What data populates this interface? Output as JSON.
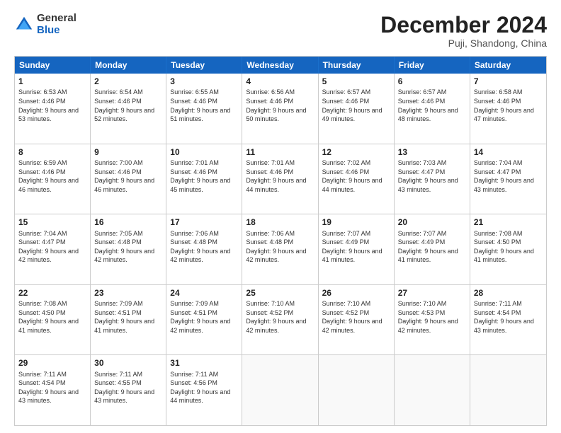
{
  "logo": {
    "general": "General",
    "blue": "Blue"
  },
  "title": "December 2024",
  "subtitle": "Puji, Shandong, China",
  "header_days": [
    "Sunday",
    "Monday",
    "Tuesday",
    "Wednesday",
    "Thursday",
    "Friday",
    "Saturday"
  ],
  "rows": [
    [
      {
        "day": "1",
        "sunrise": "Sunrise: 6:53 AM",
        "sunset": "Sunset: 4:46 PM",
        "daylight": "Daylight: 9 hours and 53 minutes."
      },
      {
        "day": "2",
        "sunrise": "Sunrise: 6:54 AM",
        "sunset": "Sunset: 4:46 PM",
        "daylight": "Daylight: 9 hours and 52 minutes."
      },
      {
        "day": "3",
        "sunrise": "Sunrise: 6:55 AM",
        "sunset": "Sunset: 4:46 PM",
        "daylight": "Daylight: 9 hours and 51 minutes."
      },
      {
        "day": "4",
        "sunrise": "Sunrise: 6:56 AM",
        "sunset": "Sunset: 4:46 PM",
        "daylight": "Daylight: 9 hours and 50 minutes."
      },
      {
        "day": "5",
        "sunrise": "Sunrise: 6:57 AM",
        "sunset": "Sunset: 4:46 PM",
        "daylight": "Daylight: 9 hours and 49 minutes."
      },
      {
        "day": "6",
        "sunrise": "Sunrise: 6:57 AM",
        "sunset": "Sunset: 4:46 PM",
        "daylight": "Daylight: 9 hours and 48 minutes."
      },
      {
        "day": "7",
        "sunrise": "Sunrise: 6:58 AM",
        "sunset": "Sunset: 4:46 PM",
        "daylight": "Daylight: 9 hours and 47 minutes."
      }
    ],
    [
      {
        "day": "8",
        "sunrise": "Sunrise: 6:59 AM",
        "sunset": "Sunset: 4:46 PM",
        "daylight": "Daylight: 9 hours and 46 minutes."
      },
      {
        "day": "9",
        "sunrise": "Sunrise: 7:00 AM",
        "sunset": "Sunset: 4:46 PM",
        "daylight": "Daylight: 9 hours and 46 minutes."
      },
      {
        "day": "10",
        "sunrise": "Sunrise: 7:01 AM",
        "sunset": "Sunset: 4:46 PM",
        "daylight": "Daylight: 9 hours and 45 minutes."
      },
      {
        "day": "11",
        "sunrise": "Sunrise: 7:01 AM",
        "sunset": "Sunset: 4:46 PM",
        "daylight": "Daylight: 9 hours and 44 minutes."
      },
      {
        "day": "12",
        "sunrise": "Sunrise: 7:02 AM",
        "sunset": "Sunset: 4:46 PM",
        "daylight": "Daylight: 9 hours and 44 minutes."
      },
      {
        "day": "13",
        "sunrise": "Sunrise: 7:03 AM",
        "sunset": "Sunset: 4:47 PM",
        "daylight": "Daylight: 9 hours and 43 minutes."
      },
      {
        "day": "14",
        "sunrise": "Sunrise: 7:04 AM",
        "sunset": "Sunset: 4:47 PM",
        "daylight": "Daylight: 9 hours and 43 minutes."
      }
    ],
    [
      {
        "day": "15",
        "sunrise": "Sunrise: 7:04 AM",
        "sunset": "Sunset: 4:47 PM",
        "daylight": "Daylight: 9 hours and 42 minutes."
      },
      {
        "day": "16",
        "sunrise": "Sunrise: 7:05 AM",
        "sunset": "Sunset: 4:48 PM",
        "daylight": "Daylight: 9 hours and 42 minutes."
      },
      {
        "day": "17",
        "sunrise": "Sunrise: 7:06 AM",
        "sunset": "Sunset: 4:48 PM",
        "daylight": "Daylight: 9 hours and 42 minutes."
      },
      {
        "day": "18",
        "sunrise": "Sunrise: 7:06 AM",
        "sunset": "Sunset: 4:48 PM",
        "daylight": "Daylight: 9 hours and 42 minutes."
      },
      {
        "day": "19",
        "sunrise": "Sunrise: 7:07 AM",
        "sunset": "Sunset: 4:49 PM",
        "daylight": "Daylight: 9 hours and 41 minutes."
      },
      {
        "day": "20",
        "sunrise": "Sunrise: 7:07 AM",
        "sunset": "Sunset: 4:49 PM",
        "daylight": "Daylight: 9 hours and 41 minutes."
      },
      {
        "day": "21",
        "sunrise": "Sunrise: 7:08 AM",
        "sunset": "Sunset: 4:50 PM",
        "daylight": "Daylight: 9 hours and 41 minutes."
      }
    ],
    [
      {
        "day": "22",
        "sunrise": "Sunrise: 7:08 AM",
        "sunset": "Sunset: 4:50 PM",
        "daylight": "Daylight: 9 hours and 41 minutes."
      },
      {
        "day": "23",
        "sunrise": "Sunrise: 7:09 AM",
        "sunset": "Sunset: 4:51 PM",
        "daylight": "Daylight: 9 hours and 41 minutes."
      },
      {
        "day": "24",
        "sunrise": "Sunrise: 7:09 AM",
        "sunset": "Sunset: 4:51 PM",
        "daylight": "Daylight: 9 hours and 42 minutes."
      },
      {
        "day": "25",
        "sunrise": "Sunrise: 7:10 AM",
        "sunset": "Sunset: 4:52 PM",
        "daylight": "Daylight: 9 hours and 42 minutes."
      },
      {
        "day": "26",
        "sunrise": "Sunrise: 7:10 AM",
        "sunset": "Sunset: 4:52 PM",
        "daylight": "Daylight: 9 hours and 42 minutes."
      },
      {
        "day": "27",
        "sunrise": "Sunrise: 7:10 AM",
        "sunset": "Sunset: 4:53 PM",
        "daylight": "Daylight: 9 hours and 42 minutes."
      },
      {
        "day": "28",
        "sunrise": "Sunrise: 7:11 AM",
        "sunset": "Sunset: 4:54 PM",
        "daylight": "Daylight: 9 hours and 43 minutes."
      }
    ],
    [
      {
        "day": "29",
        "sunrise": "Sunrise: 7:11 AM",
        "sunset": "Sunset: 4:54 PM",
        "daylight": "Daylight: 9 hours and 43 minutes."
      },
      {
        "day": "30",
        "sunrise": "Sunrise: 7:11 AM",
        "sunset": "Sunset: 4:55 PM",
        "daylight": "Daylight: 9 hours and 43 minutes."
      },
      {
        "day": "31",
        "sunrise": "Sunrise: 7:11 AM",
        "sunset": "Sunset: 4:56 PM",
        "daylight": "Daylight: 9 hours and 44 minutes."
      },
      null,
      null,
      null,
      null
    ]
  ]
}
